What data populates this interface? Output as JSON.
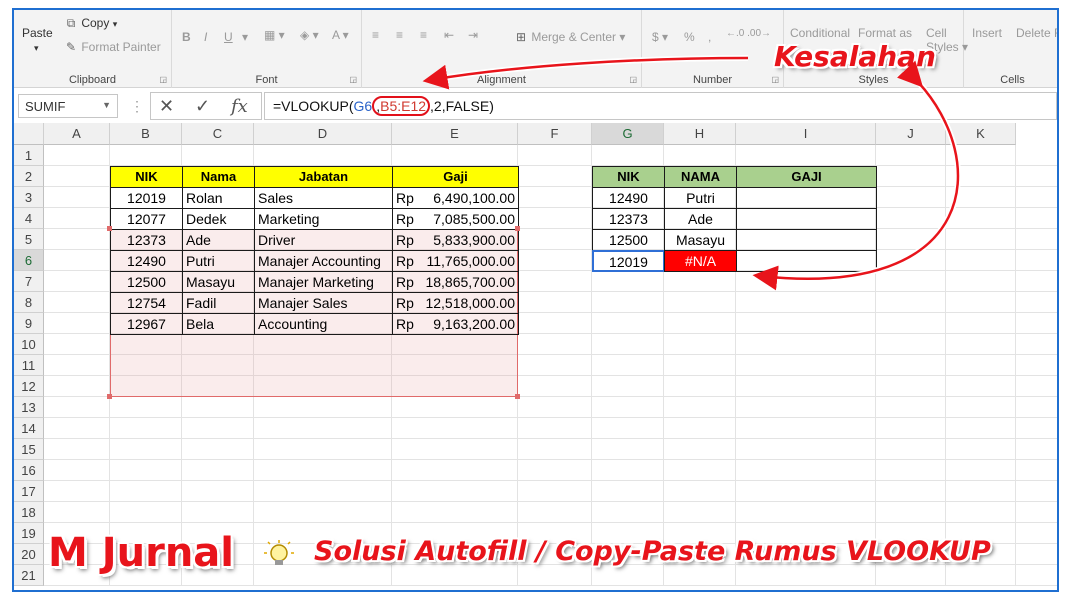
{
  "ribbon": {
    "clipboard": {
      "paste": "Paste",
      "copy": "Copy",
      "format_painter": "Format Painter",
      "label": "Clipboard"
    },
    "font": {
      "label": "Font",
      "bold": "B",
      "italic": "I",
      "underline": "U"
    },
    "alignment": {
      "label": "Alignment",
      "merge": "Merge & Center"
    },
    "number": {
      "label": "Number",
      "percent": "%",
      "comma": ","
    },
    "styles": {
      "label": "Styles",
      "conditional": "Conditional",
      "format_as": "Format as",
      "cell": "Cell",
      "cell_styles": "Styles"
    },
    "cells": {
      "label": "Cells",
      "insert": "Insert",
      "delete": "Delete",
      "format": "Fo"
    }
  },
  "formula_bar": {
    "name_box": "SUMIF",
    "fx": "fx",
    "formula_prefix": "=VLOOKUP(",
    "ref1": "G6",
    "comma1": ",",
    "ref2": "B5:E12",
    "formula_suffix": ",2,FALSE)"
  },
  "columns": [
    "A",
    "B",
    "C",
    "D",
    "E",
    "F",
    "G",
    "H",
    "I",
    "J",
    "K"
  ],
  "rows": [
    "1",
    "2",
    "3",
    "4",
    "5",
    "6",
    "7",
    "8",
    "9",
    "10",
    "11",
    "12",
    "13",
    "14",
    "15",
    "16",
    "17",
    "18",
    "19",
    "20",
    "21"
  ],
  "table1": {
    "headers": [
      "NIK",
      "Nama",
      "Jabatan",
      "Gaji"
    ],
    "rows": [
      {
        "nik": "12019",
        "nama": "Rolan",
        "jabatan": "Sales",
        "rp": "Rp",
        "gaji": "6,490,100.00"
      },
      {
        "nik": "12077",
        "nama": "Dedek",
        "jabatan": "Marketing",
        "rp": "Rp",
        "gaji": "7,085,500.00"
      },
      {
        "nik": "12373",
        "nama": "Ade",
        "jabatan": "Driver",
        "rp": "Rp",
        "gaji": "5,833,900.00"
      },
      {
        "nik": "12490",
        "nama": "Putri",
        "jabatan": "Manajer Accounting",
        "rp": "Rp",
        "gaji": "11,765,000.00"
      },
      {
        "nik": "12500",
        "nama": "Masayu",
        "jabatan": "Manajer Marketing",
        "rp": "Rp",
        "gaji": "18,865,700.00"
      },
      {
        "nik": "12754",
        "nama": "Fadil",
        "jabatan": "Manajer Sales",
        "rp": "Rp",
        "gaji": "12,518,000.00"
      },
      {
        "nik": "12967",
        "nama": "Bela",
        "jabatan": "Accounting",
        "rp": "Rp",
        "gaji": "9,163,200.00"
      }
    ]
  },
  "table2": {
    "headers": [
      "NIK",
      "NAMA",
      "GAJI"
    ],
    "rows": [
      {
        "nik": "12490",
        "nama": "Putri",
        "gaji": ""
      },
      {
        "nik": "12373",
        "nama": "Ade",
        "gaji": ""
      },
      {
        "nik": "12500",
        "nama": "Masayu",
        "gaji": ""
      },
      {
        "nik": "12019",
        "nama": "#N/A",
        "gaji": ""
      }
    ]
  },
  "overlay": {
    "callout": "Kesalahan",
    "brand": "M Jurnal",
    "title": "Solusi Autofill / Copy-Paste Rumus VLOOKUP"
  },
  "colors": {
    "accent_red": "#e8141b",
    "header_yellow": "#ffff00",
    "header_green": "#a9d08e",
    "error_red": "#ff0000",
    "frame_blue": "#1f6fd1"
  }
}
